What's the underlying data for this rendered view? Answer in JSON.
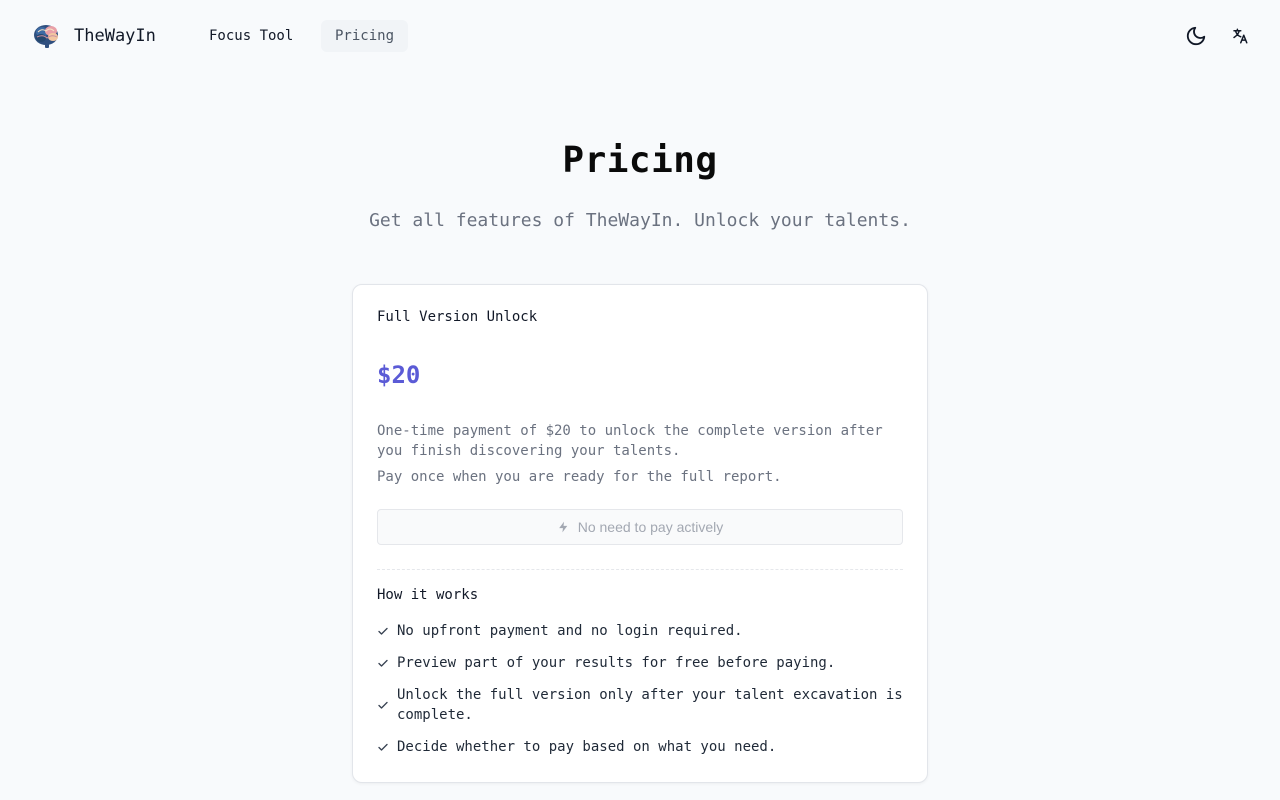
{
  "header": {
    "brand": "TheWayIn",
    "nav": {
      "focus_tool": "Focus Tool",
      "pricing": "Pricing"
    },
    "icons": {
      "logo": "brain-logo-icon",
      "theme": "moon-icon",
      "language": "translate-icon"
    }
  },
  "page": {
    "title": "Pricing",
    "subtitle": "Get all features of TheWayIn. Unlock your talents."
  },
  "card": {
    "title": "Full Version Unlock",
    "price": "$20",
    "description": "One-time payment of $20 to unlock the complete version after you finish discovering your talents.",
    "note": "Pay once when you are ready for the full report.",
    "button_label": "No need to pay actively",
    "how_title": "How it works",
    "features": [
      "No upfront payment and no login required.",
      "Preview part of your results for free before paying.",
      "Unlock the full version only after your talent excavation is complete.",
      "Decide whether to pay based on what you need."
    ]
  },
  "colors": {
    "accent": "#5b5bd6",
    "background": "#f8fafc",
    "muted_text": "#6b7280"
  }
}
